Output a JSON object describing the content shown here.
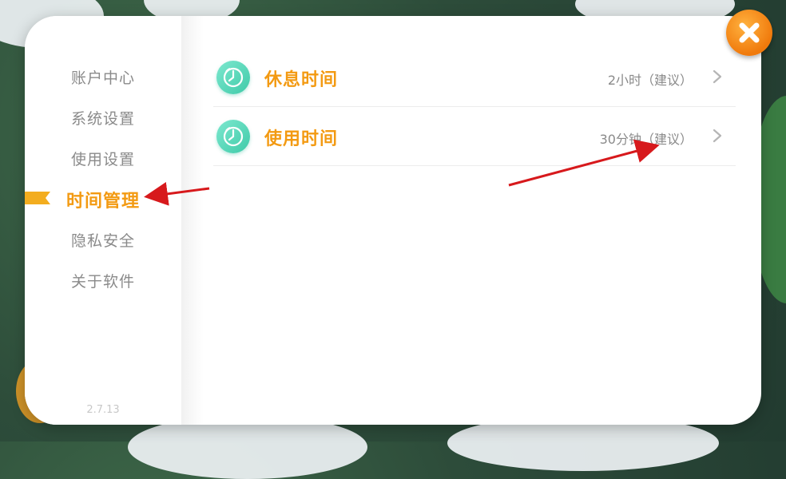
{
  "sidebar": {
    "items": [
      {
        "label": "账户中心"
      },
      {
        "label": "系统设置"
      },
      {
        "label": "使用设置"
      },
      {
        "label": "时间管理",
        "active": true
      },
      {
        "label": "隐私安全"
      },
      {
        "label": "关于软件"
      }
    ],
    "version": "2.7.13"
  },
  "settings": {
    "rows": [
      {
        "title": "休息时间",
        "value": "2小时（建议）",
        "icon": "clock-icon"
      },
      {
        "title": "使用时间",
        "value": "30分钟（建议）",
        "icon": "clock-icon"
      }
    ]
  },
  "colors": {
    "accent": "#f39a12",
    "icon_teal": "#3fcaa8",
    "muted_text": "#8a8a8a",
    "annotation_arrow": "#d7191c"
  },
  "icons": {
    "close": "close-icon",
    "active_marker": "flag-marker-icon",
    "row_chevron": "chevron-right-icon"
  }
}
